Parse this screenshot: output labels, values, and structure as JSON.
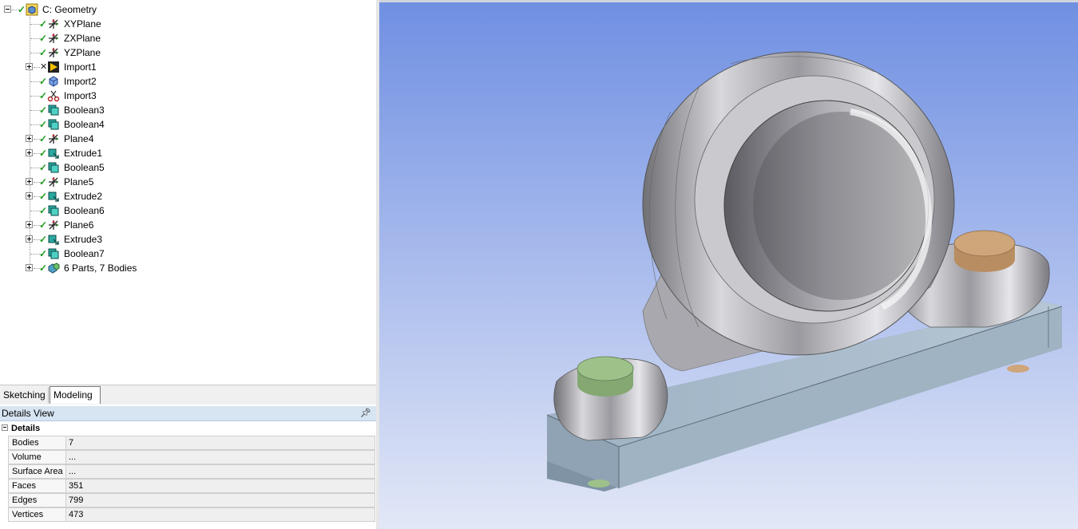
{
  "tree": {
    "root": "C: Geometry",
    "items": [
      {
        "label": "XYPlane",
        "icon": "plane-icon",
        "expander": "none",
        "status": "check"
      },
      {
        "label": "ZXPlane",
        "icon": "plane-icon",
        "expander": "none",
        "status": "check"
      },
      {
        "label": "YZPlane",
        "icon": "plane-icon",
        "expander": "none",
        "status": "check"
      },
      {
        "label": "Import1",
        "icon": "import-warning-icon",
        "expander": "plus",
        "status": "cross"
      },
      {
        "label": "Import2",
        "icon": "import-icon",
        "expander": "none",
        "status": "check"
      },
      {
        "label": "Import3",
        "icon": "scissors-icon",
        "expander": "none",
        "status": "check"
      },
      {
        "label": "Boolean3",
        "icon": "boolean-icon",
        "expander": "none",
        "status": "check"
      },
      {
        "label": "Boolean4",
        "icon": "boolean-icon",
        "expander": "none",
        "status": "check"
      },
      {
        "label": "Plane4",
        "icon": "plane-icon",
        "expander": "plus",
        "status": "check"
      },
      {
        "label": "Extrude1",
        "icon": "extrude-icon",
        "expander": "plus",
        "status": "check"
      },
      {
        "label": "Boolean5",
        "icon": "boolean-icon",
        "expander": "none",
        "status": "check"
      },
      {
        "label": "Plane5",
        "icon": "plane-icon",
        "expander": "plus",
        "status": "check"
      },
      {
        "label": "Extrude2",
        "icon": "extrude-icon",
        "expander": "plus",
        "status": "check"
      },
      {
        "label": "Boolean6",
        "icon": "boolean-icon",
        "expander": "none",
        "status": "check"
      },
      {
        "label": "Plane6",
        "icon": "plane-icon",
        "expander": "plus",
        "status": "check"
      },
      {
        "label": "Extrude3",
        "icon": "extrude-icon",
        "expander": "plus",
        "status": "check"
      },
      {
        "label": "Boolean7",
        "icon": "boolean-icon",
        "expander": "none",
        "status": "check"
      },
      {
        "label": "6 Parts, 7 Bodies",
        "icon": "parts-icon",
        "expander": "plus",
        "status": "check"
      }
    ]
  },
  "tabs": {
    "sketching": "Sketching",
    "modeling": "Modeling",
    "active": "modeling"
  },
  "details": {
    "title": "Details View",
    "group": "Details",
    "rows": [
      {
        "key": "Bodies",
        "value": "7"
      },
      {
        "key": "Volume",
        "value": "..."
      },
      {
        "key": "Surface Area",
        "value": "..."
      },
      {
        "key": "Faces",
        "value": "351"
      },
      {
        "key": "Edges",
        "value": "799"
      },
      {
        "key": "Vertices",
        "value": "473"
      }
    ]
  },
  "colors": {
    "viewport_top": "#6f8fe2",
    "viewport_bottom": "#e3e8f7",
    "base_plate": "#a9bccc",
    "bolt_green": "#9cc28a",
    "bolt_tan": "#cfa57a",
    "housing": "#b9b9bd",
    "check": "#1d9a1d",
    "details_header": "#d7e4f2"
  }
}
